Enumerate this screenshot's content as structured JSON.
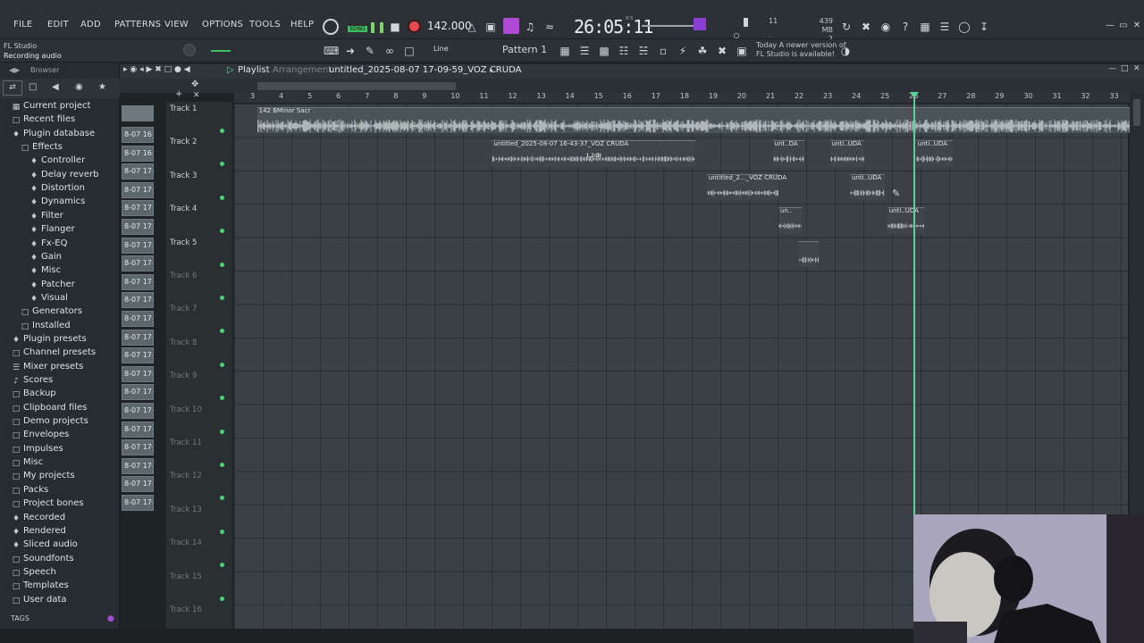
{
  "menu": [
    "FILE",
    "EDIT",
    "ADD",
    "PATTERNS",
    "VIEW",
    "OPTIONS",
    "TOOLS",
    "HELP"
  ],
  "hint": {
    "app": "FL Studio",
    "status": "Recording audio"
  },
  "transport": {
    "mode_badge": "SONG",
    "tempo": "142.000",
    "time": "26:05:11",
    "time_suffix": "B:S"
  },
  "cpu": {
    "voices": "11",
    "memory": "439 MB",
    "count": "2"
  },
  "snap": "Line",
  "pattern_selector": "Pattern 1",
  "news": {
    "line1": "Today  A newer version of",
    "line2": "FL Studio is available!"
  },
  "browser": {
    "title": "Browser",
    "items": [
      {
        "label": "Current project",
        "icon": "file-icon",
        "indent": 0
      },
      {
        "label": "Recent files",
        "icon": "folder-icon",
        "indent": 0
      },
      {
        "label": "Plugin database",
        "icon": "plugin-icon",
        "indent": 0
      },
      {
        "label": "Effects",
        "icon": "folder-icon",
        "indent": 1
      },
      {
        "label": "Controller",
        "icon": "plugin-icon",
        "indent": 2
      },
      {
        "label": "Delay reverb",
        "icon": "plugin-icon",
        "indent": 2
      },
      {
        "label": "Distortion",
        "icon": "plugin-icon",
        "indent": 2
      },
      {
        "label": "Dynamics",
        "icon": "plugin-icon",
        "indent": 2
      },
      {
        "label": "Filter",
        "icon": "plugin-icon",
        "indent": 2
      },
      {
        "label": "Flanger",
        "icon": "plugin-icon",
        "indent": 2
      },
      {
        "label": "Fx-EQ",
        "icon": "plugin-icon",
        "indent": 2
      },
      {
        "label": "Gain",
        "icon": "plugin-icon",
        "indent": 2
      },
      {
        "label": "Misc",
        "icon": "plugin-icon",
        "indent": 2
      },
      {
        "label": "Patcher",
        "icon": "plugin-icon",
        "indent": 2
      },
      {
        "label": "Visual",
        "icon": "plugin-icon",
        "indent": 2
      },
      {
        "label": "Generators",
        "icon": "folder-icon",
        "indent": 1
      },
      {
        "label": "Installed",
        "icon": "folder-icon",
        "indent": 1
      },
      {
        "label": "Plugin presets",
        "icon": "plugin-icon",
        "indent": 0
      },
      {
        "label": "Channel presets",
        "icon": "folder-icon",
        "indent": 0
      },
      {
        "label": "Mixer presets",
        "icon": "mixer-icon",
        "indent": 0
      },
      {
        "label": "Scores",
        "icon": "note-icon",
        "indent": 0
      },
      {
        "label": "Backup",
        "icon": "folder-icon",
        "indent": 0
      },
      {
        "label": "Clipboard files",
        "icon": "folder-icon",
        "indent": 0
      },
      {
        "label": "Demo projects",
        "icon": "folder-icon",
        "indent": 0
      },
      {
        "label": "Envelopes",
        "icon": "folder-icon",
        "indent": 0
      },
      {
        "label": "Impulses",
        "icon": "folder-icon",
        "indent": 0
      },
      {
        "label": "Misc",
        "icon": "folder-icon",
        "indent": 0
      },
      {
        "label": "My projects",
        "icon": "folder-icon",
        "indent": 0
      },
      {
        "label": "Packs",
        "icon": "folder-icon",
        "indent": 0
      },
      {
        "label": "Project bones",
        "icon": "folder-icon",
        "indent": 0
      },
      {
        "label": "Recorded",
        "icon": "plugin-icon",
        "indent": 0
      },
      {
        "label": "Rendered",
        "icon": "plugin-icon",
        "indent": 0
      },
      {
        "label": "Sliced audio",
        "icon": "plugin-icon",
        "indent": 0
      },
      {
        "label": "Soundfonts",
        "icon": "folder-icon",
        "indent": 0
      },
      {
        "label": "Speech",
        "icon": "folder-icon",
        "indent": 0
      },
      {
        "label": "Templates",
        "icon": "folder-icon",
        "indent": 0
      },
      {
        "label": "User data",
        "icon": "folder-icon",
        "indent": 0
      }
    ],
    "tags": "TAGS"
  },
  "playlist": {
    "title": "Playlist",
    "subtitle": "Arrangement",
    "project": "untitled_2025-08-07 17-09-59_VOZ CRUDA",
    "pattern_clips": [
      "8-07 16-",
      "8-07 16-",
      "8-07 17-",
      "8-07 17-",
      "8-07 17-",
      "8-07 17-",
      "8-07 17-",
      "8-07 17-",
      "8-07 17-",
      "8-07 17-",
      "8-07 17-",
      "8-07 17-",
      "8-07 17-",
      "8-07 17-",
      "8-07 17-",
      "8-07 17-",
      "8-07 17-",
      "8-07 17-",
      "8-07 17-",
      "8-07 17-",
      "8-07 17-"
    ],
    "tracks": [
      "Track 1",
      "Track 2",
      "Track 3",
      "Track 4",
      "Track 5",
      "Track 6",
      "Track 7",
      "Track 8",
      "Track 9",
      "Track 10",
      "Track 11",
      "Track 12",
      "Track 13",
      "Track 14",
      "Track 15",
      "Track 16"
    ],
    "ruler": [
      "3",
      "4",
      "5",
      "6",
      "7",
      "8",
      "9",
      "10",
      "11",
      "12",
      "13",
      "14",
      "15",
      "16",
      "17",
      "18",
      "19",
      "20",
      "21",
      "22",
      "23",
      "24",
      "25",
      "26",
      "27",
      "28",
      "29",
      "30",
      "31",
      "32",
      "33"
    ],
    "clips": [
      {
        "track": 0,
        "start": 2.8,
        "length": 31,
        "label": "142 BMinor Sacr"
      },
      {
        "track": 1,
        "start": 11.0,
        "length": 7.1,
        "label": "untitled_2025-08-07 16-43-37_VOZ CRUDA",
        "tag": "1.2dB"
      },
      {
        "track": 1,
        "start": 20.8,
        "length": 1.1,
        "label": "unt..DA"
      },
      {
        "track": 1,
        "start": 22.8,
        "length": 1.2,
        "label": "unti..UDA"
      },
      {
        "track": 1,
        "start": 25.8,
        "length": 1.3,
        "label": "unti..UDA"
      },
      {
        "track": 2,
        "start": 18.5,
        "length": 2.5,
        "label": "untitled_2..._VOZ CRUDA"
      },
      {
        "track": 2,
        "start": 23.5,
        "length": 1.2,
        "label": "unti..UDA"
      },
      {
        "track": 3,
        "start": 21.0,
        "length": 0.8,
        "label": "un.."
      },
      {
        "track": 3,
        "start": 24.8,
        "length": 1.3,
        "label": "unti..UDA"
      },
      {
        "track": 4,
        "start": 21.7,
        "length": 0.7,
        "label": ""
      }
    ]
  }
}
